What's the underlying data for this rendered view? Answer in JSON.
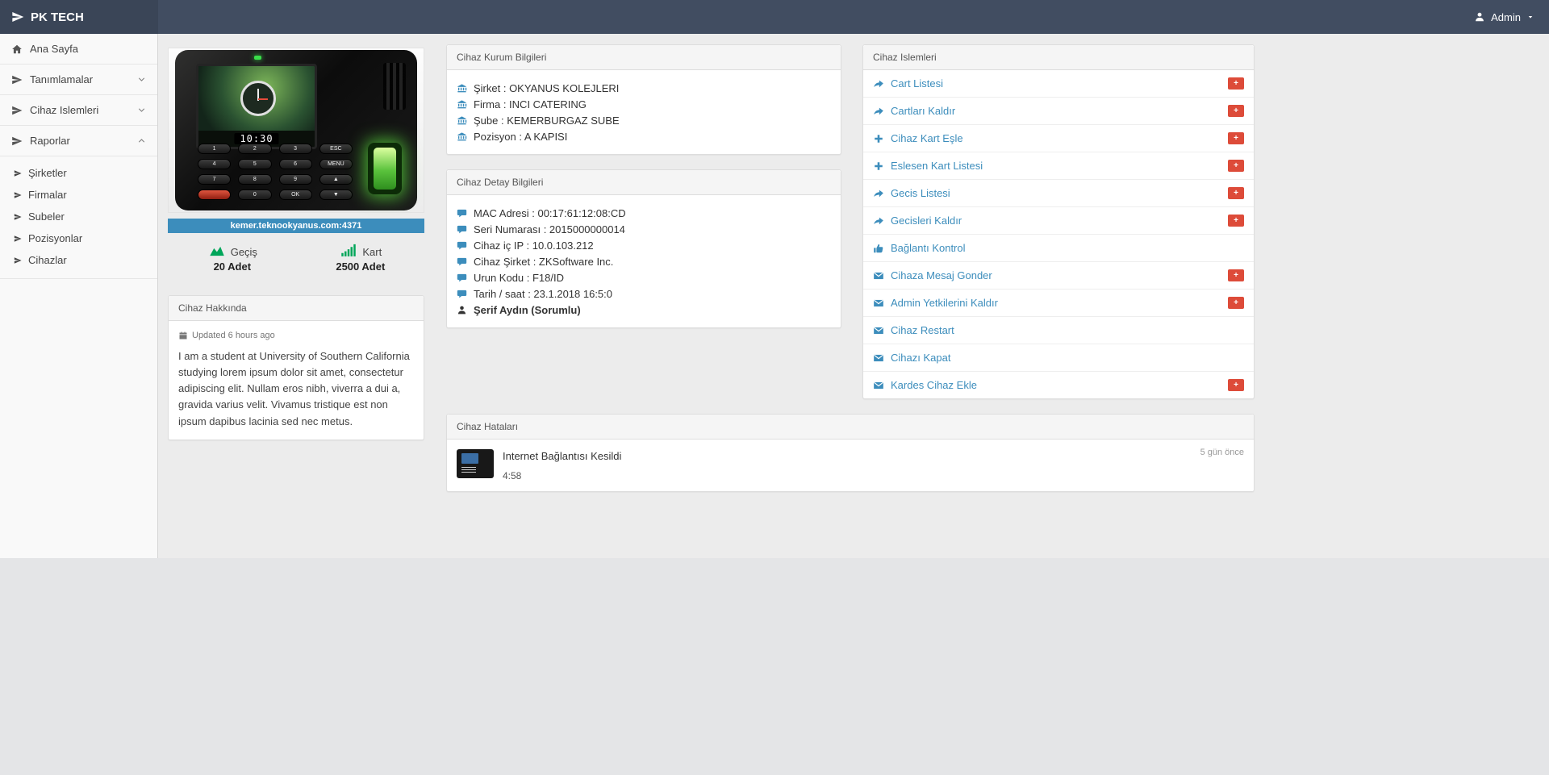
{
  "navbar": {
    "brand": "PK TECH",
    "user_label": "Admin"
  },
  "sidebar": {
    "home": "Ana Sayfa",
    "groups": [
      {
        "label": "Tanımlamalar",
        "state": "collapsed"
      },
      {
        "label": "Cihaz Islemleri",
        "state": "collapsed"
      },
      {
        "label": "Raporlar",
        "state": "expanded"
      }
    ],
    "report_items": [
      "Şirketler",
      "Firmalar",
      "Subeler",
      "Pozisyonlar",
      "Cihazlar"
    ]
  },
  "device_card": {
    "address": "kemer.teknookyanus.com:4371",
    "screen_clock": "10:30",
    "keys": [
      "1",
      "2",
      "3",
      "ESC",
      "4",
      "5",
      "6",
      "MENU",
      "7",
      "8",
      "9",
      "▲",
      "",
      "0",
      "OK",
      "▼"
    ],
    "stats": [
      {
        "label": "Geçiş",
        "value": "20 Adet",
        "icon": "area-chart-icon",
        "color": "#00a65a"
      },
      {
        "label": "Kart",
        "value": "2500 Adet",
        "icon": "signal-bars-icon",
        "color": "#00a65a"
      }
    ]
  },
  "about_panel": {
    "title": "Cihaz Hakkında",
    "updated": "Updated 6 hours ago",
    "body": "I am a student at University of Southern California studying lorem ipsum dolor sit amet, consectetur adipiscing elit. Nullam eros nibh, viverra a dui a, gravida varius velit. Vivamus tristique est non ipsum dapibus lacinia sed nec metus."
  },
  "kurum_panel": {
    "title": "Cihaz Kurum Bilgileri",
    "rows": [
      "Şirket : OKYANUS KOLEJLERI",
      "Firma : INCI CATERING",
      "Şube : KEMERBURGAZ SUBE",
      "Pozisyon : A KAPISI"
    ]
  },
  "detay_panel": {
    "title": "Cihaz Detay Bilgileri",
    "rows": [
      "MAC Adresi : 00:17:61:12:08:CD",
      "Seri Numarası : 2015000000014",
      "Cihaz iç IP : 10.0.103.212",
      "Cihaz Şirket : ZKSoftware Inc.",
      "Urun Kodu : F18/ID",
      "Tarih / saat : 23.1.2018 16:5:0"
    ],
    "responsible": "Şerif Aydın (Sorumlu)"
  },
  "islemler_panel": {
    "title": "Cihaz Islemleri",
    "badge_label": "+",
    "items": [
      {
        "label": "Cart Listesi",
        "icon": "share-icon",
        "badge": true
      },
      {
        "label": "Cartları Kaldır",
        "icon": "share-icon",
        "badge": true
      },
      {
        "label": "Cihaz Kart Eşle",
        "icon": "plus-icon",
        "badge": true
      },
      {
        "label": "Eslesen Kart Listesi",
        "icon": "plus-icon",
        "badge": true
      },
      {
        "label": "Gecis Listesi",
        "icon": "share-icon",
        "badge": true
      },
      {
        "label": "Gecisleri Kaldır",
        "icon": "share-icon",
        "badge": true
      },
      {
        "label": "Bağlantı Kontrol",
        "icon": "thumbs-up-icon",
        "badge": false
      },
      {
        "label": "Cihaza Mesaj Gonder",
        "icon": "envelope-icon",
        "badge": true
      },
      {
        "label": "Admin Yetkilerini Kaldır",
        "icon": "envelope-icon",
        "badge": true
      },
      {
        "label": "Cihaz Restart",
        "icon": "envelope-icon",
        "badge": false
      },
      {
        "label": "Cihazı Kapat",
        "icon": "envelope-icon",
        "badge": false
      },
      {
        "label": "Kardes Cihaz Ekle",
        "icon": "envelope-icon",
        "badge": true
      }
    ]
  },
  "hatalar_panel": {
    "title": "Cihaz Hataları",
    "items": [
      {
        "message": "Internet Bağlantısı Kesildi",
        "time": "4:58",
        "ago": "5 gün önce"
      }
    ]
  },
  "colors": {
    "navbar": "#414d61",
    "accent_blue": "#3c8dbc",
    "badge_red": "#dd4b39",
    "stat_green": "#00a65a"
  }
}
